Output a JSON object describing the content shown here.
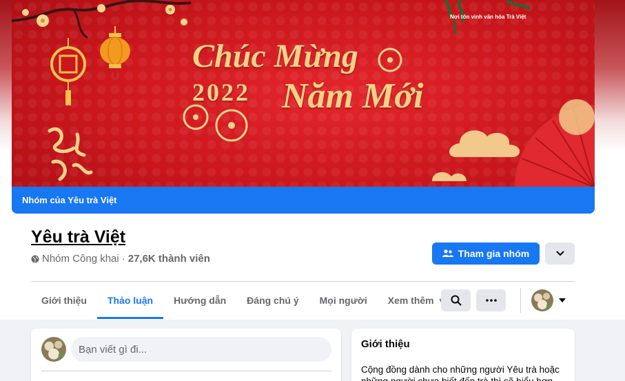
{
  "cover": {
    "logo_tagline": "Nơi tôn vinh văn hóa Trà Việt",
    "greeting_line1": "Chúc Mừng",
    "greeting_year": "2022",
    "greeting_line2": "Năm Mới",
    "group_label": "Nhóm của Yêu trà Việt"
  },
  "group": {
    "title": "Yêu trà Việt",
    "privacy": "Nhóm Công khai",
    "separator": "·",
    "members": "27,6K thành viên",
    "join_label": "Tham gia nhóm"
  },
  "tabs": [
    {
      "label": "Giới thiệu"
    },
    {
      "label": "Thảo luận",
      "active": true
    },
    {
      "label": "Hướng dẫn"
    },
    {
      "label": "Đáng chú ý"
    },
    {
      "label": "Mọi người"
    },
    {
      "label": "Xem thêm"
    }
  ],
  "composer": {
    "placeholder": "Bạn viết gì đi..."
  },
  "about": {
    "title": "Giới thiệu",
    "text": "Cộng đồng dành cho những người Yêu trà hoặc những người chưa biết đến trà thì sẽ hiểu hơn về"
  },
  "colors": {
    "accent": "#1877f2",
    "cover_red": "#c9161c",
    "gold": "#f2d289"
  },
  "icons": {
    "globe": "globe-icon",
    "join": "group-join-icon",
    "chevron": "chevron-down-icon",
    "search": "search-icon",
    "more": "more-dots-icon"
  }
}
